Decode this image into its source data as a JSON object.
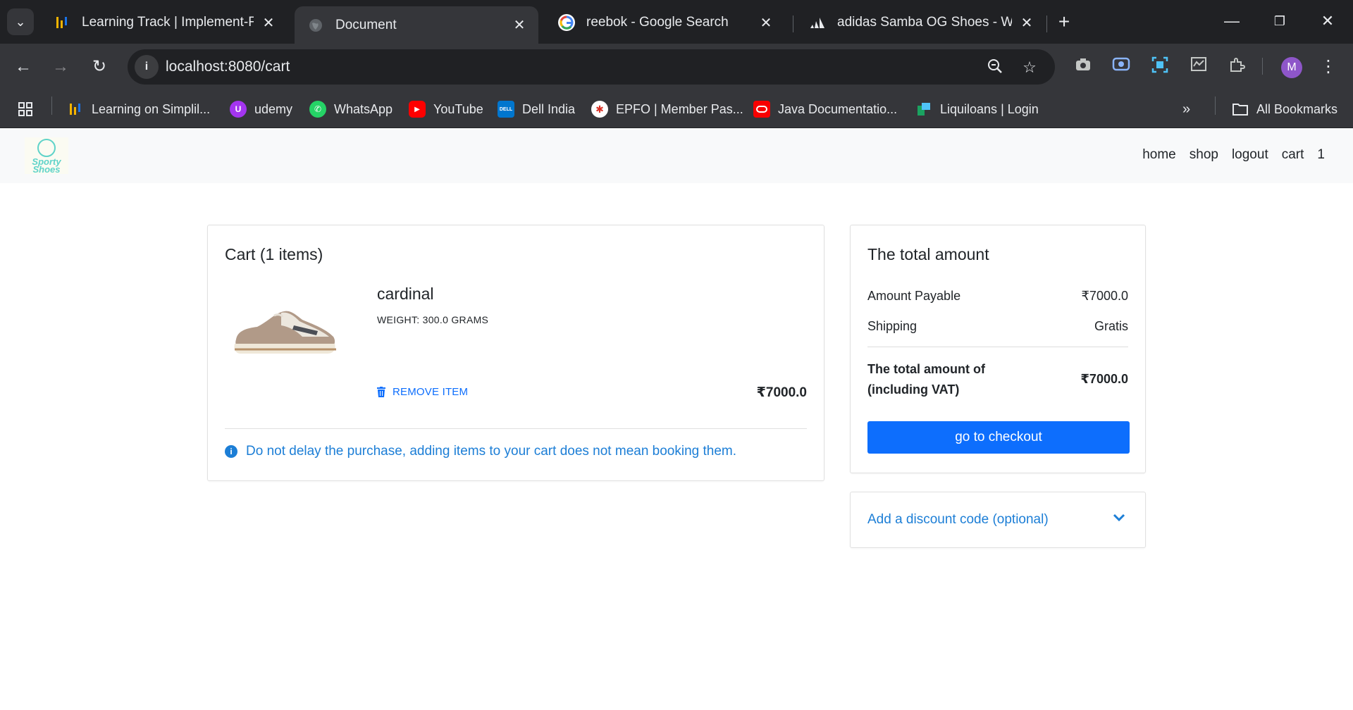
{
  "browser": {
    "tabs": [
      {
        "title": "Learning Track | Implement-Fra",
        "favicon": "simplilearn-icon",
        "active": false
      },
      {
        "title": "Document",
        "favicon": "globe-icon",
        "active": true
      },
      {
        "title": "reebok - Google Search",
        "favicon": "google-icon",
        "active": false
      },
      {
        "title": "adidas Samba OG Shoes - Whit",
        "favicon": "adidas-icon",
        "active": false
      }
    ],
    "url": "localhost:8080/cart",
    "avatar_letter": "M",
    "bookmarks": [
      {
        "label": "Learning on Simplil...",
        "icon": "simplilearn-icon",
        "color": "#f5b400"
      },
      {
        "label": "udemy",
        "icon": "udemy-icon",
        "color": "#a435f0"
      },
      {
        "label": "WhatsApp",
        "icon": "whatsapp-icon",
        "color": "#25d366"
      },
      {
        "label": "YouTube",
        "icon": "youtube-icon",
        "color": "#ff0000"
      },
      {
        "label": "Dell India",
        "icon": "dell-icon",
        "color": "#0076ce"
      },
      {
        "label": "EPFO | Member Pas...",
        "icon": "epfo-icon",
        "color": "#d93025"
      },
      {
        "label": "Java Documentatio...",
        "icon": "oracle-icon",
        "color": "#f80000"
      },
      {
        "label": "Liquiloans | Login",
        "icon": "liquiloans-icon",
        "color": "#1aa260"
      }
    ],
    "all_bookmarks": "All Bookmarks"
  },
  "site": {
    "logo_text": [
      "Sporty",
      "Shoes"
    ],
    "nav": [
      "home",
      "shop",
      "logout",
      "cart",
      "1"
    ]
  },
  "cart": {
    "title": "Cart (1 items)",
    "item": {
      "name": "cardinal",
      "weight": "WEIGHT: 300.0 GRAMS",
      "remove_label": "REMOVE ITEM",
      "price": "₹7000.0"
    },
    "notice": "Do not delay the purchase, adding items to your cart does not mean booking them."
  },
  "summary": {
    "title": "The total amount",
    "amount_label": "Amount Payable",
    "amount_value": "₹7000.0",
    "shipping_label": "Shipping",
    "shipping_value": "Gratis",
    "total_label_1": "The total amount of",
    "total_label_2": "(including VAT)",
    "total_value": "₹7000.0",
    "checkout_label": "go to checkout"
  },
  "discount": {
    "label": "Add a discount code (optional)"
  },
  "colors": {
    "accent": "#0d6efd",
    "link": "#1c7ed6",
    "chrome_dark": "#202124",
    "chrome_toolbar": "#35363a"
  }
}
